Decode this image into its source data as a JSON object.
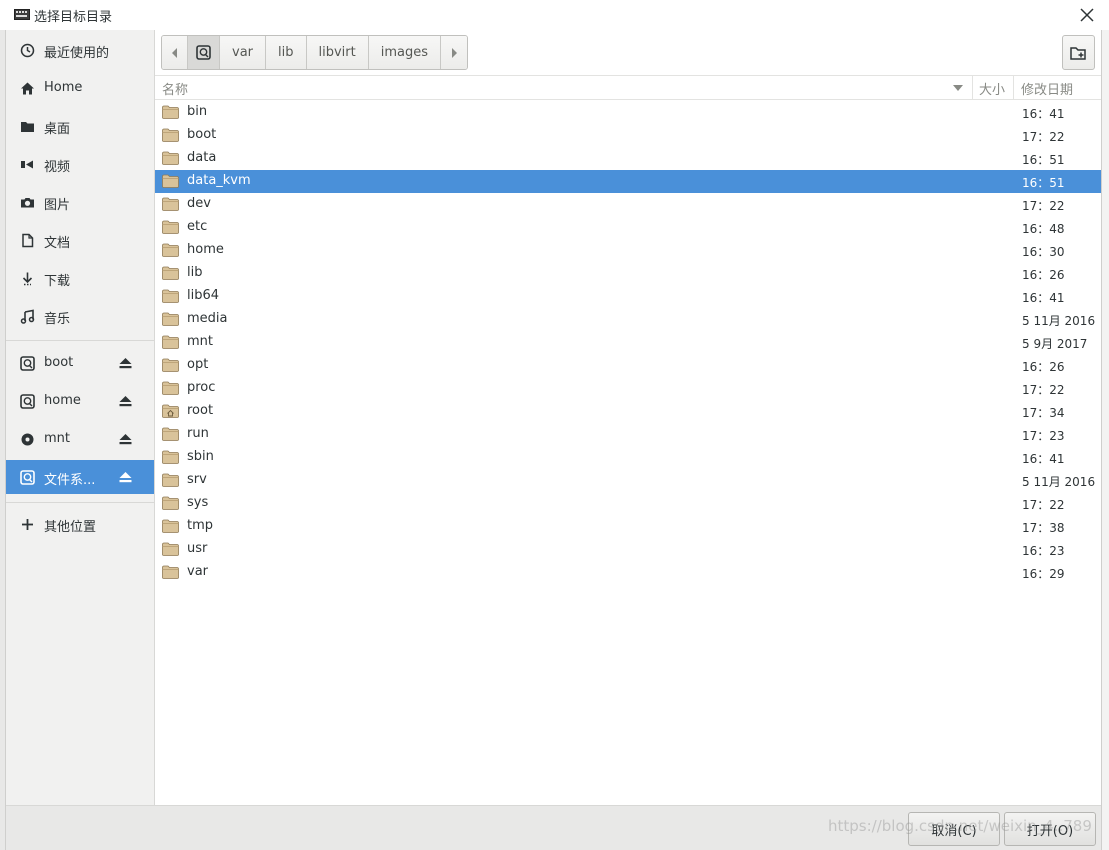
{
  "window": {
    "title": "选择目标目录",
    "close_icon": "close-icon"
  },
  "sidebar": {
    "places": [
      {
        "label": "最近使用的",
        "icon": "recent-clock-icon"
      },
      {
        "label": "Home",
        "icon": "home-icon"
      },
      {
        "label": "桌面",
        "icon": "desktop-folder-icon"
      },
      {
        "label": "视频",
        "icon": "video-icon"
      },
      {
        "label": "图片",
        "icon": "camera-icon"
      },
      {
        "label": "文档",
        "icon": "document-icon"
      },
      {
        "label": "下载",
        "icon": "download-icon"
      },
      {
        "label": "音乐",
        "icon": "music-icon"
      }
    ],
    "devices": [
      {
        "label": "boot",
        "icon": "drive-icon",
        "eject": true,
        "active": false
      },
      {
        "label": "home",
        "icon": "drive-icon",
        "eject": true,
        "active": false
      },
      {
        "label": "mnt",
        "icon": "disc-icon",
        "eject": true,
        "active": false
      },
      {
        "label": "文件系...",
        "icon": "drive-icon",
        "eject": true,
        "active": true
      }
    ],
    "other_locations": {
      "label": "其他位置",
      "icon": "plus-icon"
    }
  },
  "pathbar": {
    "segments": [
      "var",
      "lib",
      "libvirt",
      "images"
    ]
  },
  "columns": {
    "name": "名称",
    "size": "大小",
    "modified": "修改日期"
  },
  "files": [
    {
      "name": "bin",
      "modified": "16：41"
    },
    {
      "name": "boot",
      "modified": "17：22"
    },
    {
      "name": "data",
      "modified": "16：51"
    },
    {
      "name": "data_kvm",
      "modified": "16：51",
      "selected": true
    },
    {
      "name": "dev",
      "modified": "17：22"
    },
    {
      "name": "etc",
      "modified": "16：48"
    },
    {
      "name": "home",
      "modified": "16：30"
    },
    {
      "name": "lib",
      "modified": "16：26"
    },
    {
      "name": "lib64",
      "modified": "16：41"
    },
    {
      "name": "media",
      "modified": "5 11月 2016"
    },
    {
      "name": "mnt",
      "modified": "5 9月 2017"
    },
    {
      "name": "opt",
      "modified": "16：26"
    },
    {
      "name": "proc",
      "modified": "17：22"
    },
    {
      "name": "root",
      "modified": "17：34",
      "icon": "home-folder-icon"
    },
    {
      "name": "run",
      "modified": "17：23"
    },
    {
      "name": "sbin",
      "modified": "16：41"
    },
    {
      "name": "srv",
      "modified": "5 11月 2016"
    },
    {
      "name": "sys",
      "modified": "17：22"
    },
    {
      "name": "tmp",
      "modified": "17：38"
    },
    {
      "name": "usr",
      "modified": "16：23"
    },
    {
      "name": "var",
      "modified": "16：29"
    }
  ],
  "buttons": {
    "cancel": "取消(C)",
    "open": "打开(O)"
  },
  "watermark": "https://blog.csdn.net/weixin_4..789",
  "colors": {
    "selection": "#4a90d9",
    "folder": "#d9c39a"
  }
}
